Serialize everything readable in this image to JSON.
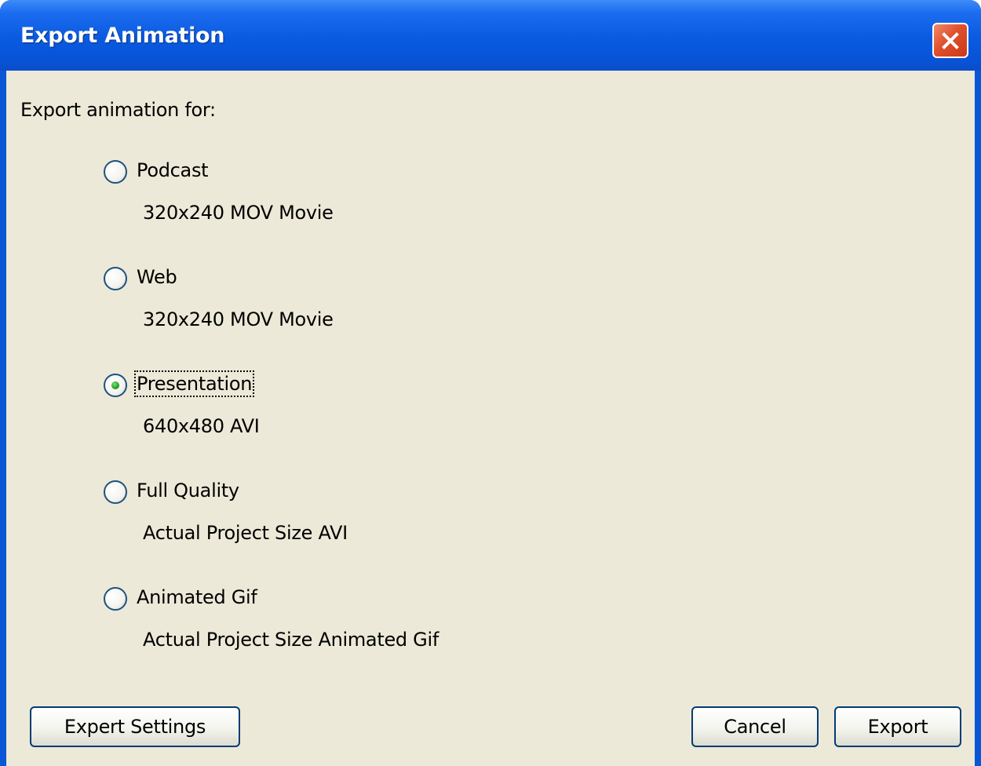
{
  "window": {
    "title": "Export Animation"
  },
  "dialog": {
    "prompt": "Export animation for:",
    "options": [
      {
        "label": "Podcast",
        "description": "320x240 MOV Movie",
        "selected": false
      },
      {
        "label": "Web",
        "description": "320x240 MOV Movie",
        "selected": false
      },
      {
        "label": "Presentation",
        "description": "640x480 AVI",
        "selected": true
      },
      {
        "label": "Full Quality",
        "description": "Actual Project Size AVI",
        "selected": false
      },
      {
        "label": "Animated Gif",
        "description": "Actual Project Size Animated Gif",
        "selected": false
      }
    ]
  },
  "buttons": {
    "expert_settings": "Expert Settings",
    "cancel": "Cancel",
    "export": "Export"
  },
  "icons": {
    "close": "close-icon",
    "radio": "radio-button"
  },
  "colors": {
    "titlebar": "#0a5ae0",
    "client_bg": "#ece9d8",
    "close_button": "#e0502c",
    "radio_selected_dot": "#21a121"
  }
}
